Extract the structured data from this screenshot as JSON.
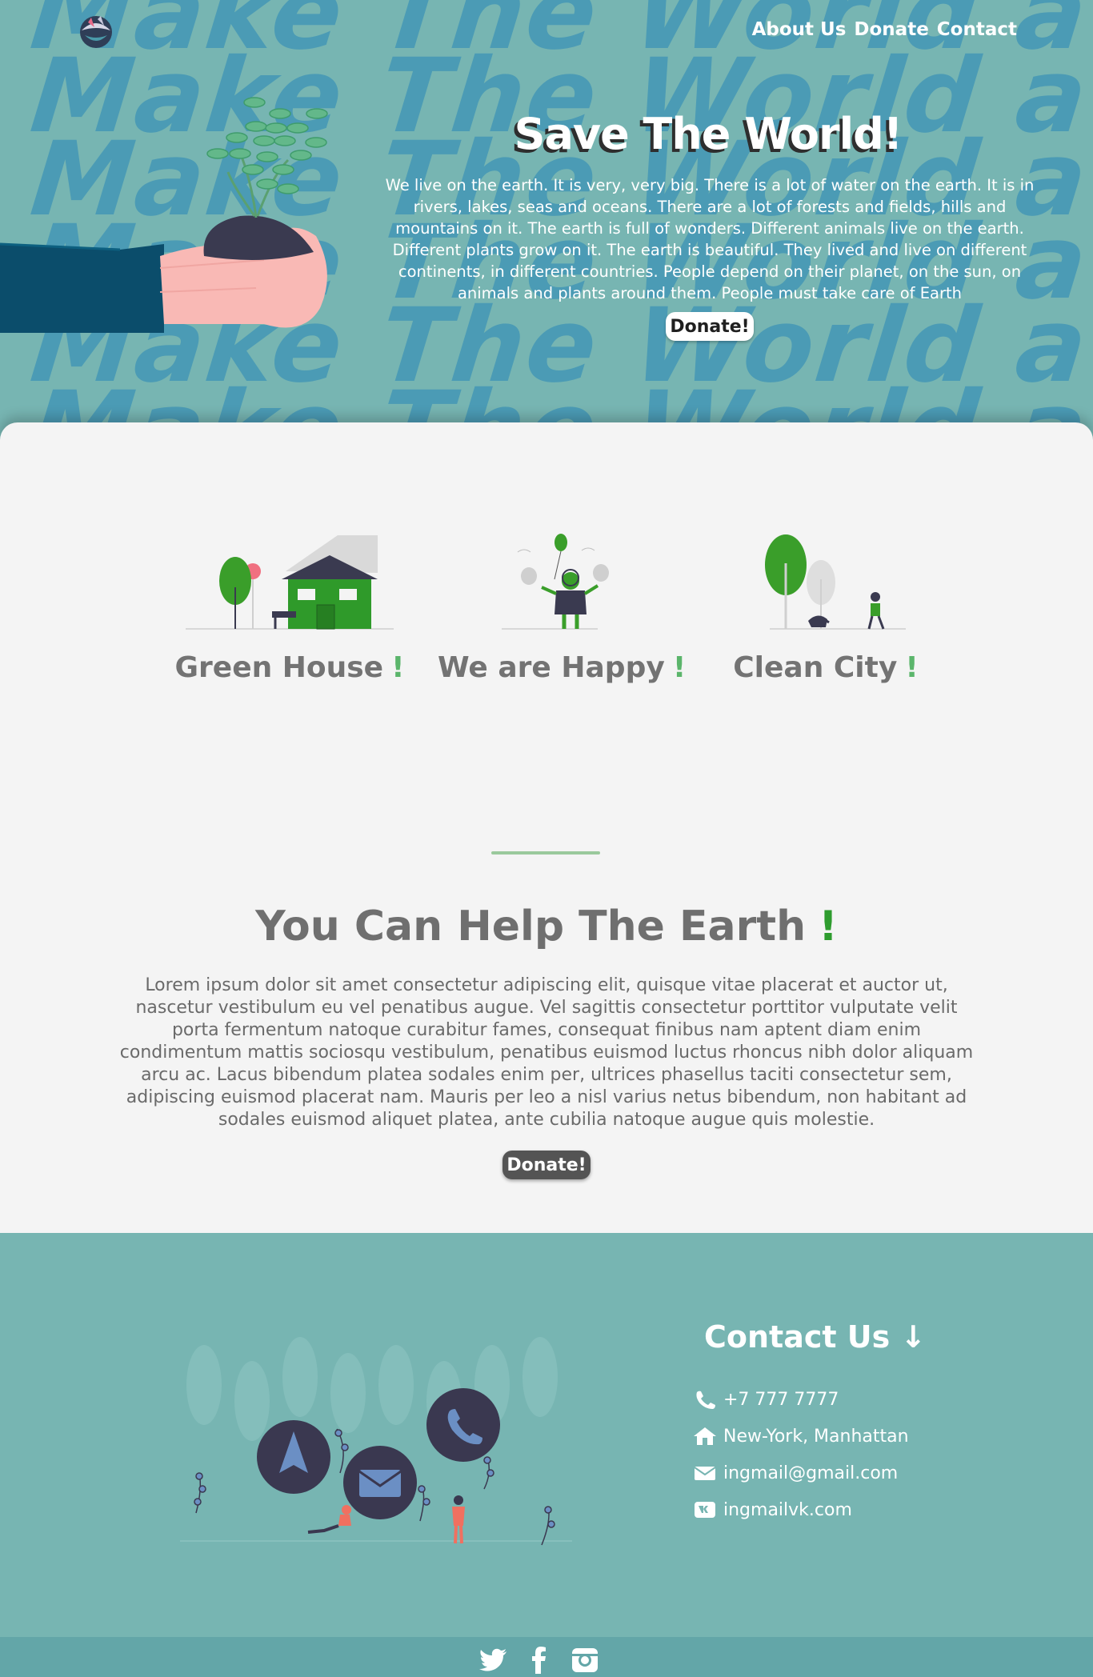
{
  "hero": {
    "background_words": "Make The World a Better",
    "nav": [
      "About Us",
      "Donate",
      "Contact"
    ],
    "title": "Save The World!",
    "text": "We live on the earth. It is very, very big. There is a lot of water on the earth. It is in rivers, lakes, seas and oceans. There are a lot of forests and fields, hills and mountains on it. The earth is full of wonders. Different animals live on the earth. Different plants grow on it. The earth is beautiful. They lived and live on different continents, in different countries. People depend on their planet, on the sun, on animals and plants around them. People must take care of Earth",
    "donate_label": "Donate!"
  },
  "features": [
    {
      "label": "Green House",
      "mark": "!"
    },
    {
      "label": "We are Happy",
      "mark": "!"
    },
    {
      "label": "Clean City",
      "mark": "!"
    }
  ],
  "help": {
    "title": "You Can Help The Earth",
    "mark": "!",
    "text": "Lorem ipsum dolor sit amet consectetur adipiscing elit, quisque vitae placerat et auctor ut, nascetur vestibulum eu vel penatibus augue. Vel sagittis consectetur porttitor vulputate velit porta fermentum natoque curabitur fames, consequat finibus nam aptent diam enim condimentum mattis sociosqu vestibulum, penatibus euismod luctus rhoncus nibh dolor aliquam arcu ac. Lacus bibendum platea sodales enim per, ultrices phasellus taciti consectetur sem, adipiscing euismod placerat nam. Mauris per leo a nisl varius netus bibendum, non habitant ad sodales euismod aliquet platea, ante cubilia natoque augue quis molestie.",
    "donate_label": "Donate!"
  },
  "contact": {
    "title": "Contact Us ↓",
    "items": [
      {
        "icon": "phone-icon",
        "text": "+7 777 7777"
      },
      {
        "icon": "home-icon",
        "text": "New-York, Manhattan"
      },
      {
        "icon": "envelope-icon",
        "text": "ingmail@gmail.com"
      },
      {
        "icon": "vk-icon",
        "text": "ingmailvk.com"
      }
    ]
  },
  "social": [
    "twitter-icon",
    "facebook-icon",
    "instagram-icon"
  ],
  "colors": {
    "teal": "#77b5b2",
    "bg_text": "#4b9bb5",
    "green": "#2e9c2e",
    "light_bg": "#f4f4f4",
    "grey_text": "#737373"
  }
}
